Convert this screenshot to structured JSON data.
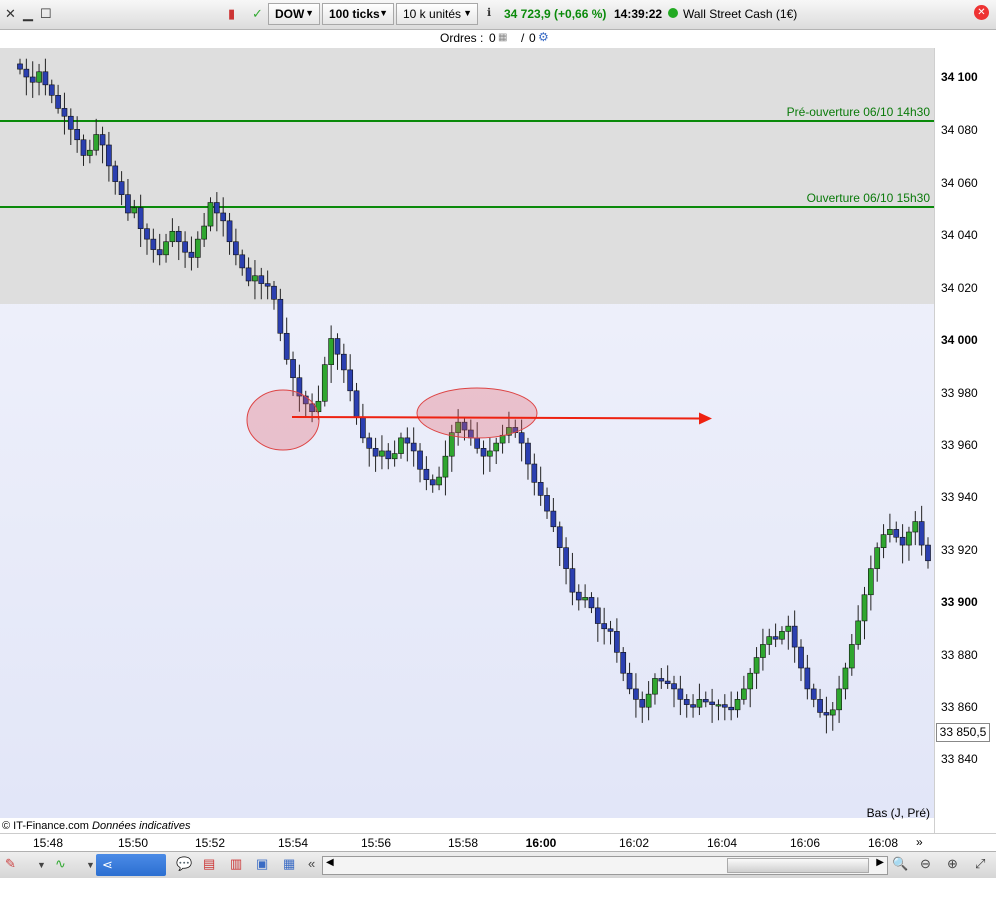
{
  "toolbar": {
    "symbol": "DOW",
    "interval": "100 ticks",
    "quantity": "10 k unités",
    "quote": "34 723,9 (+0,66 %)",
    "time": "14:39:22",
    "instrument": "Wall Street Cash (1€)",
    "colors": {
      "quote": "#0a8a0a",
      "status_dot": "#22aa22"
    }
  },
  "orders": {
    "label": "Ordres :",
    "count_a": "0",
    "count_b": "0",
    "separator": "/"
  },
  "chart": {
    "level_preopen": "Pré-ouverture 06/10 14h30",
    "level_open": "Ouverture 06/10 15h30",
    "price_box": "33 850,5",
    "footer_source": "© IT-Finance.com",
    "footer_note": "Données indicatives",
    "footer_right": "Bas (J, Pré)",
    "y_ticks": [
      "34 100",
      "34 080",
      "34 060",
      "34 040",
      "34 020",
      "34 000",
      "33 980",
      "33 960",
      "33 940",
      "33 920",
      "33 900",
      "33 880",
      "33 860",
      "33 840"
    ],
    "x_ticks": [
      "15:48",
      "15:50",
      "15:52",
      "15:54",
      "15:56",
      "15:58",
      "16:00",
      "16:02",
      "16:04",
      "16:06",
      "16:08"
    ]
  },
  "chart_data": {
    "type": "candlestick",
    "y_range": [
      33820,
      34110
    ],
    "levels": [
      {
        "label": "Pré-ouverture 06/10 14h30",
        "value": 34084
      },
      {
        "label": "Ouverture 06/10 15h30",
        "value": 34051
      }
    ],
    "premarket_shading_until": 34013,
    "path": [
      34103,
      34100,
      34098,
      34102,
      34097,
      34093,
      34088,
      34085,
      34080,
      34076,
      34070,
      34072,
      34078,
      34074,
      34066,
      34060,
      34055,
      34048,
      34050,
      34042,
      34038,
      34034,
      34032,
      34037,
      34041,
      34037,
      34033,
      34031,
      34038,
      34043,
      34052,
      34048,
      34045,
      34037,
      34032,
      34027,
      34022,
      34024,
      34021,
      34020,
      34015,
      34002,
      33992,
      33985,
      33978,
      33975,
      33972,
      33976,
      33990,
      34000,
      33994,
      33988,
      33980,
      33970,
      33962,
      33958,
      33955,
      33957,
      33954,
      33956,
      33962,
      33960,
      33957,
      33950,
      33946,
      33944,
      33947,
      33955,
      33964,
      33968,
      33965,
      33962,
      33958,
      33955,
      33957,
      33960,
      33963,
      33966,
      33964,
      33960,
      33952,
      33945,
      33940,
      33934,
      33928,
      33920,
      33912,
      33903,
      33900,
      33901,
      33897,
      33891,
      33889,
      33888,
      33880,
      33872,
      33866,
      33862,
      33859,
      33864,
      33870,
      33869,
      33868,
      33866,
      33862,
      33860,
      33859,
      33862,
      33861,
      33860,
      33860,
      33859,
      33858,
      33862,
      33866,
      33872,
      33878,
      33883,
      33886,
      33885,
      33888,
      33890,
      33882,
      33874,
      33866,
      33862,
      33857,
      33856,
      33858,
      33866,
      33874,
      33883,
      33892,
      33902,
      33912,
      33920,
      33925,
      33927,
      33924,
      33921,
      33926,
      33930,
      33921,
      33915
    ],
    "arrow_level": 33970,
    "highlight_regions": [
      "15:54 low",
      "15:58 high"
    ]
  }
}
